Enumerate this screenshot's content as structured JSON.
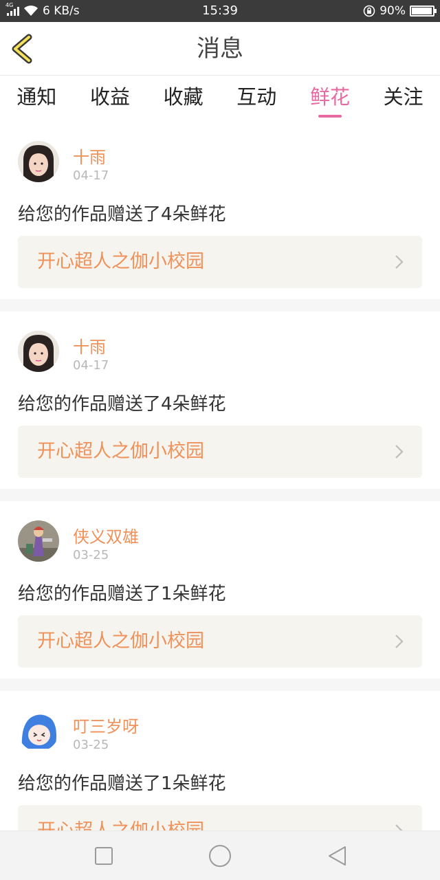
{
  "status_bar": {
    "network_speed": "6 KB/s",
    "network_type": "4G",
    "time": "15:39",
    "battery": "90%",
    "battery_level": 0.9
  },
  "header": {
    "title": "消息",
    "back_icon": "chevron-left-icon"
  },
  "tabs": [
    {
      "label": "通知",
      "active": false
    },
    {
      "label": "收益",
      "active": false
    },
    {
      "label": "收藏",
      "active": false
    },
    {
      "label": "互动",
      "active": false
    },
    {
      "label": "鲜花",
      "active": true
    },
    {
      "label": "关注",
      "active": false
    }
  ],
  "messages": [
    {
      "user": "十雨",
      "date": "04-17",
      "text": "给您的作品赠送了4朵鲜花",
      "work": "开心超人之伽小校园"
    },
    {
      "user": "十雨",
      "date": "04-17",
      "text": "给您的作品赠送了4朵鲜花",
      "work": "开心超人之伽小校园"
    },
    {
      "user": "侠义双雄",
      "date": "03-25",
      "text": "给您的作品赠送了1朵鲜花",
      "work": "开心超人之伽小校园"
    },
    {
      "user": "叮三岁呀",
      "date": "03-25",
      "text": "给您的作品赠送了1朵鲜花",
      "work": "开心超人之伽小校园"
    }
  ],
  "colors": {
    "accent_pink": "#e86aa3",
    "username_orange": "#f0915a",
    "link_bg": "#f5f4ee"
  }
}
